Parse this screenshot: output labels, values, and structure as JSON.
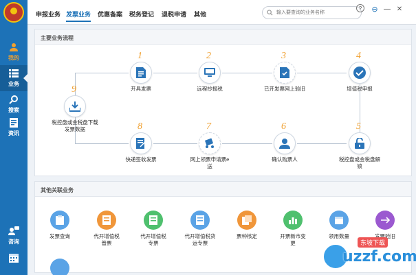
{
  "sidebar": {
    "items": [
      {
        "label": "我的",
        "icon": "user-icon"
      },
      {
        "label": "业务",
        "icon": "list-icon"
      },
      {
        "label": "搜索",
        "icon": "search-icon"
      },
      {
        "label": "资讯",
        "icon": "document-icon"
      },
      {
        "label": "咨询",
        "icon": "chat-icon"
      },
      {
        "label": "",
        "icon": "calendar-icon"
      }
    ]
  },
  "header": {
    "tabs": [
      "申报业务",
      "发票业务",
      "优惠备案",
      "税务登记",
      "退税申请",
      "其他"
    ],
    "active_tab": "发票业务",
    "search_placeholder": "输入要查询的业务名称",
    "window_buttons": [
      "?",
      "⊖",
      "—",
      "✕"
    ]
  },
  "flow": {
    "title": "主要业务流程",
    "steps": [
      {
        "num": "1",
        "label": "开具发票",
        "icon": "invoice-icon"
      },
      {
        "num": "2",
        "label": "远程抄报税",
        "icon": "monitor-icon"
      },
      {
        "num": "3",
        "label": "已开发票网上验旧",
        "icon": "verify-document-icon"
      },
      {
        "num": "4",
        "label": "增值税申报",
        "icon": "checkmark-icon"
      },
      {
        "num": "5",
        "label": "税控盘或金税盘解锁",
        "icon": "unlock-icon"
      },
      {
        "num": "6",
        "label": "确认购票人",
        "icon": "person-icon"
      },
      {
        "num": "7",
        "label": "网上领票申请票e送",
        "icon": "delivery-icon"
      },
      {
        "num": "8",
        "label": "快递签收发票",
        "icon": "sign-form-icon"
      },
      {
        "num": "9",
        "label": "税控盘或金税盘下载发票数据",
        "icon": "download-tray-icon"
      }
    ]
  },
  "others": {
    "title": "其他关联业务",
    "items": [
      {
        "label": "发票查询",
        "color": "#5aa3e6",
        "icon": "clipboard-icon"
      },
      {
        "label": "代开增值税普票",
        "color": "#f0963a",
        "icon": "receipt-icon"
      },
      {
        "label": "代开增值税专票",
        "color": "#4fc06e",
        "icon": "receipt-icon"
      },
      {
        "label": "代开增值税货运专票",
        "color": "#5aa3e6",
        "icon": "receipt-icon"
      },
      {
        "label": "票种核定",
        "color": "#f0963a",
        "icon": "stack-icon"
      },
      {
        "label": "开票新市变更",
        "color": "#4fc06e",
        "icon": "bar-chart-icon"
      },
      {
        "label": "领用数量",
        "color": "#5aa3e6",
        "icon": "calendar-icon"
      },
      {
        "label": "发票验旧",
        "color": "#9b59d0",
        "icon": "split-icon"
      }
    ],
    "extra_icon_color": "#5aa3e6"
  },
  "watermark": {
    "text": "uzzf.com",
    "badge": "东坡下载"
  }
}
